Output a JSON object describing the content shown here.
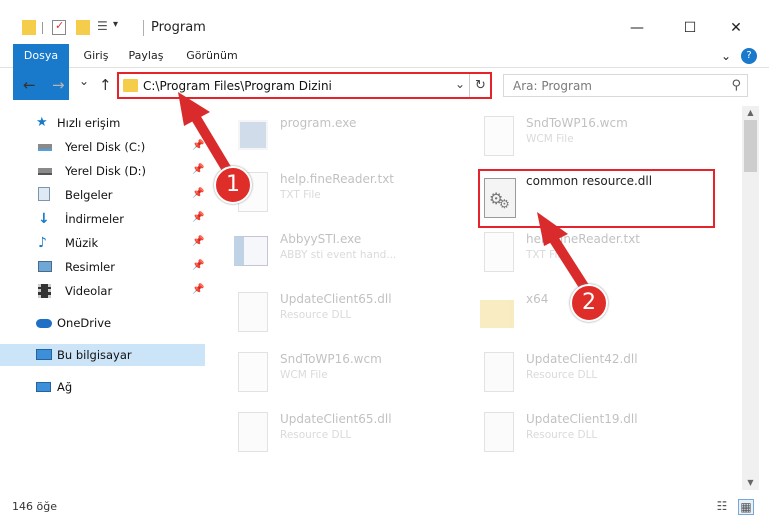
{
  "window": {
    "title": "Program",
    "minimize": "—",
    "maximize": "☐",
    "close": "✕"
  },
  "ribbon": {
    "tabs": [
      "Dosya",
      "Giriş",
      "Paylaş",
      "Görünüm"
    ],
    "expand": "⌄",
    "help": "?"
  },
  "address": {
    "path": "C:\\Program Files\\Program Dizini",
    "back": "←",
    "forward": "→",
    "recent": "⌄",
    "up": "↑",
    "dropdown": "⌄",
    "refresh": "↻"
  },
  "search": {
    "placeholder": "Ara: Program",
    "icon": "⚲"
  },
  "sidebar": {
    "quick_access": "Hızlı erişim",
    "items": [
      {
        "label": "Yerel Disk (C:)",
        "icon": "drive-icon",
        "pinned": true
      },
      {
        "label": "Yerel Disk (D:)",
        "icon": "drive-icon",
        "pinned": true
      },
      {
        "label": "Belgeler",
        "icon": "documents-icon",
        "pinned": true
      },
      {
        "label": "İndirmeler",
        "icon": "download-icon",
        "pinned": true
      },
      {
        "label": "Müzik",
        "icon": "music-icon",
        "pinned": true
      },
      {
        "label": "Resimler",
        "icon": "pictures-icon",
        "pinned": true
      },
      {
        "label": "Videolar",
        "icon": "video-icon",
        "pinned": true
      }
    ],
    "onedrive": "OneDrive",
    "this_pc": "Bu bilgisayar",
    "network": "Ağ"
  },
  "files": [
    {
      "name": "program.exe",
      "type": ""
    },
    {
      "name": "SndToWP16.wcm",
      "type": "WCM File"
    },
    {
      "name": "help.fineReader.txt",
      "type": "TXT File"
    },
    {
      "name": "common resource.dll",
      "type": ""
    },
    {
      "name": "AbbyySTI.exe",
      "type": "ABBY sti event hand..."
    },
    {
      "name": "help.fineReader.txt",
      "type": "TXT File"
    },
    {
      "name": "UpdateClient65.dll",
      "type": "Resource DLL"
    },
    {
      "name": "x64",
      "type": ""
    },
    {
      "name": "SndToWP16.wcm",
      "type": "WCM File"
    },
    {
      "name": "UpdateClient42.dll",
      "type": "Resource DLL"
    },
    {
      "name": "UpdateClient65.dll",
      "type": "Resource DLL"
    },
    {
      "name": "UpdateClient19.dll",
      "type": "Resource DLL"
    }
  ],
  "status": {
    "count": "146 öğe"
  },
  "annotations": {
    "step1": "1",
    "step2": "2",
    "color": "#e4232b"
  }
}
